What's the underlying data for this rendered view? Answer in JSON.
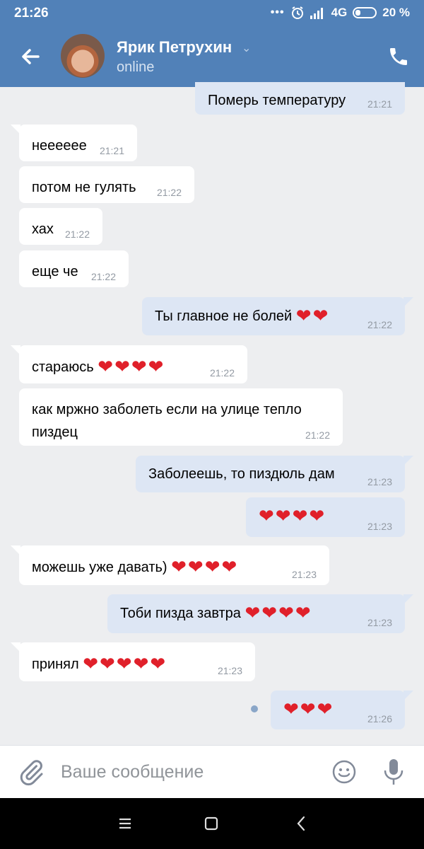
{
  "status_bar": {
    "time": "21:26",
    "dots": "•••",
    "network": "4G",
    "battery": "20 %"
  },
  "header": {
    "contact_name": "Ярик Петрухин",
    "chevron": "⌄",
    "contact_status": "online",
    "icons": {
      "back": "arrow-left-icon",
      "call": "phone-icon",
      "avatar": "avatar"
    },
    "color": "#5181b8"
  },
  "messages": [
    {
      "dir": "out",
      "text": "Померь температуру",
      "time": "21:21"
    },
    {
      "dir": "in",
      "text": "нееееее",
      "time": "21:21"
    },
    {
      "dir": "in",
      "text": "потом не гулять",
      "time": "21:22"
    },
    {
      "dir": "in",
      "text": "хах",
      "time": "21:22"
    },
    {
      "dir": "in",
      "text": "еще че",
      "time": "21:22"
    },
    {
      "dir": "out",
      "text": "Ты главное не болей",
      "hearts": "❤❤",
      "time": "21:22"
    },
    {
      "dir": "in",
      "text": "стараюсь",
      "hearts": "❤❤❤❤",
      "time": "21:22"
    },
    {
      "dir": "in",
      "text": "как мржно заболеть если на улице тепло\nпиздец",
      "time": "21:22"
    },
    {
      "dir": "out",
      "text": "Заболеешь,  то пиздюль дам",
      "time": "21:23"
    },
    {
      "dir": "out",
      "text": "",
      "hearts": "❤❤❤❤",
      "time": "21:23"
    },
    {
      "dir": "in",
      "text": "можешь уже давать)",
      "hearts": "❤❤❤❤",
      "time": "21:23"
    },
    {
      "dir": "out",
      "text": "Тоби пизда завтра",
      "hearts": "❤❤❤❤",
      "time": "21:23"
    },
    {
      "dir": "in",
      "text": "принял",
      "hearts": "❤❤❤❤❤",
      "time": "21:23"
    },
    {
      "dir": "out",
      "text": "",
      "hearts": "❤❤❤",
      "time": "21:26",
      "unread": true
    }
  ],
  "input": {
    "placeholder": "Ваше сообщение",
    "value": ""
  },
  "colors": {
    "incoming_bubble": "#ffffff",
    "outgoing_bubble": "#dde6f4",
    "background": "#edeef0",
    "heart": "#e0202a"
  }
}
